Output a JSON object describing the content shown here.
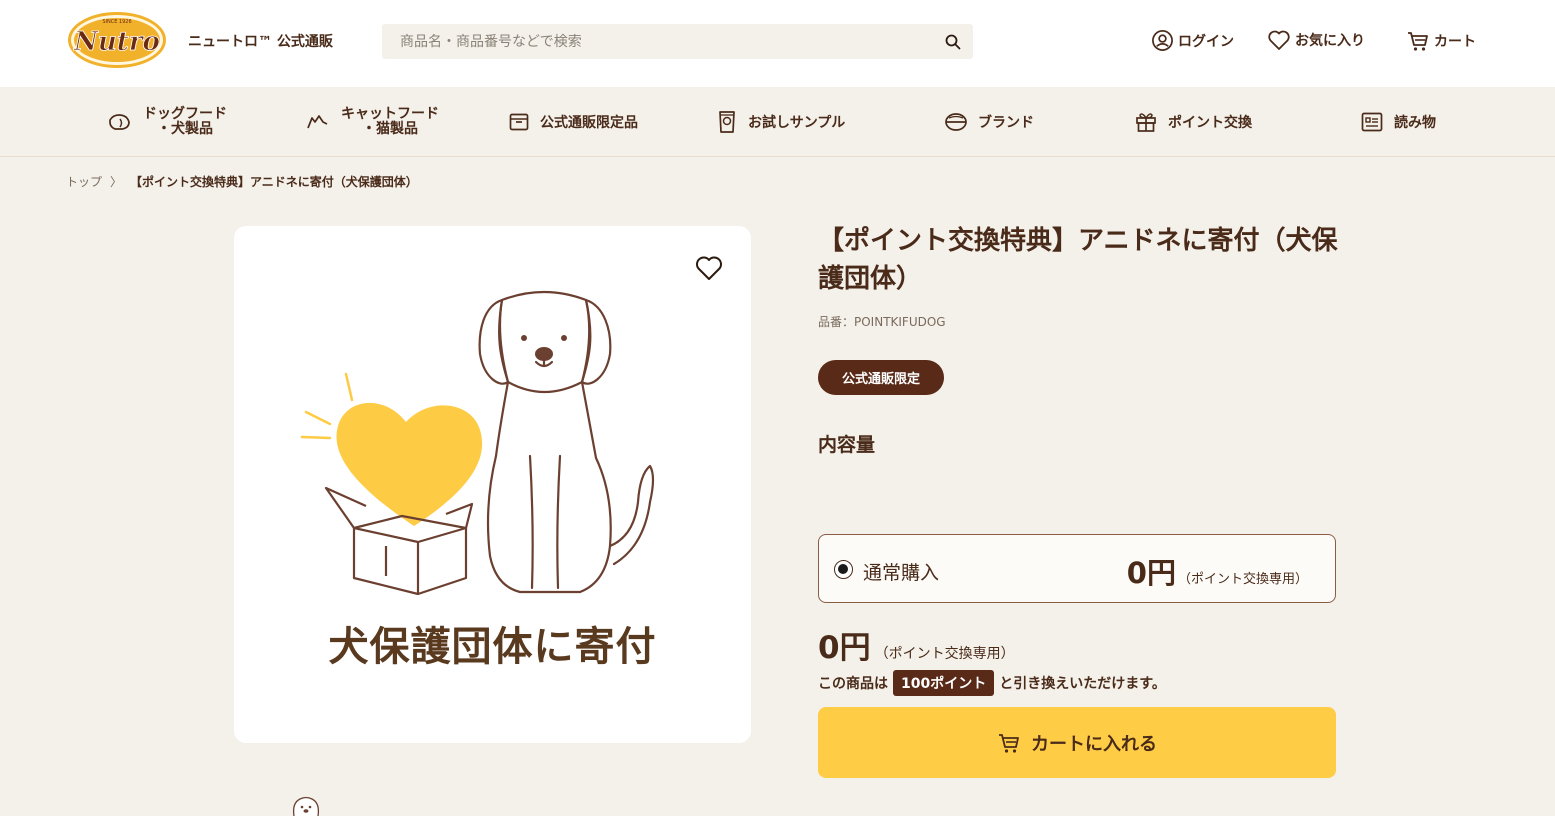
{
  "header": {
    "logo_text": "Nutro",
    "logo_since": "SINCE 1926",
    "site_name": "ニュートロ™ 公式通販",
    "search_placeholder": "商品名・商品番号などで検索",
    "login": "ログイン",
    "favorites": "お気に入り",
    "cart": "カート"
  },
  "nav": {
    "dog_food_line1": "ドッグフード",
    "dog_food_line2": "・犬製品",
    "cat_food_line1": "キャットフード",
    "cat_food_line2": "・猫製品",
    "limited": "公式通販限定品",
    "samples": "お試しサンプル",
    "brand": "ブランド",
    "points": "ポイント交換",
    "reading": "読み物"
  },
  "breadcrumb": {
    "top": "トップ",
    "separator": "〉",
    "current": "【ポイント交換特典】アニドネに寄付（犬保護団体）"
  },
  "product": {
    "title": "【ポイント交換特典】アニドネに寄付（犬保護団体）",
    "sku": "品番：POINTKIFUDOG",
    "badge": "公式通販限定",
    "volume_label": "内容量",
    "image_caption": "犬保護団体に寄付",
    "option_label": "通常購入",
    "option_price": "0円",
    "option_price_note": "（ポイント交換専用）",
    "price": "0円",
    "price_note": "（ポイント交換専用）",
    "points_prefix": "この商品は",
    "points_value": "100ポイント",
    "points_suffix": "と引き換えいただけます。",
    "cart_button": "カートに入れる"
  },
  "colors": {
    "brown": "#4a2b1a",
    "badge": "#5a2a18",
    "cart_button": "#fecd45",
    "heart": "#fecb45",
    "background": "#f4f1ea"
  }
}
